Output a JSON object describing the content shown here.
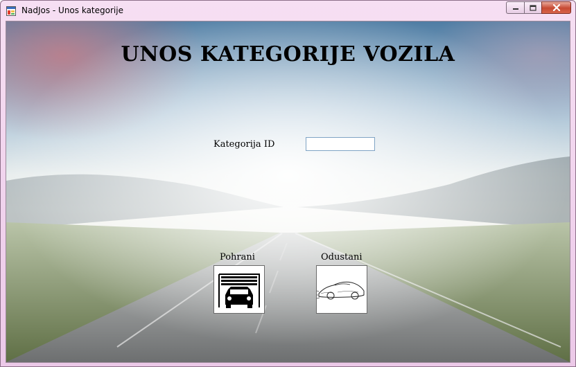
{
  "window": {
    "title": "NadJos - Unos kategorije"
  },
  "form": {
    "heading": "UNOS KATEGORIJE VOZILA",
    "id_label": "Kategorija ID",
    "id_value": "",
    "save_label": "Pohrani",
    "cancel_label": "Odustani"
  },
  "icons": {
    "app": "app-window-icon",
    "save": "garage-car-icon",
    "cancel": "sports-car-sketch-icon",
    "minimize": "minimize-icon",
    "maximize": "maximize-icon",
    "close": "close-icon"
  },
  "colors": {
    "titlebar": "#f2d6ef",
    "close_button": "#c74a33",
    "input_border": "#7fa3c4"
  }
}
